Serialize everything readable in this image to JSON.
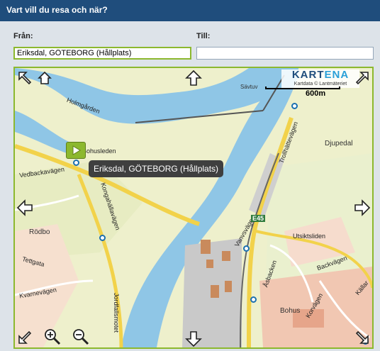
{
  "header": {
    "title": "Vart vill du resa och när?"
  },
  "form": {
    "from_label": "Från:",
    "from_value": "Eriksdal, GÖTEBORG (Hållplats)",
    "to_label": "Till:",
    "to_value": ""
  },
  "map": {
    "logo": "KARTENA",
    "logo_highlight": "ENA",
    "logo_prefix": "KART",
    "copyright": "Kartdata © Lantmäteriet",
    "scale_label": "600m",
    "tooltip": "Eriksdal, GÖTEBORG (Hållplats)",
    "places": {
      "djupedal": "Djupedal",
      "rodbo": "Rödbo",
      "bohus": "Bohus",
      "savtuv": "Sävtuv"
    },
    "roads": {
      "holmgarden": "Holmgården",
      "bohusleden": "Bohusleden",
      "vedbackavagen": "Vedbackavägen",
      "kongahallavagen": "Kongahällavägen",
      "trollhattevagen": "Trollhättevägen",
      "vanasvagen": "Vanvsvägen",
      "asbacken": "Åsbacken",
      "utsiktsliden": "Utsiktsliden",
      "backvagen": "Backvägen",
      "kallar": "Källar",
      "korvagen": "Korvägen",
      "jordfallsmotet": "Jordfallsmotet",
      "tettgata": "Tettgata",
      "kvarnevagen": "Kvarnevägen"
    },
    "route_marker": "E45"
  },
  "colors": {
    "header": "#1f4d7c",
    "accent": "#8cb82e",
    "water": "#8fc6e6",
    "stop": "#1a6fb0"
  }
}
